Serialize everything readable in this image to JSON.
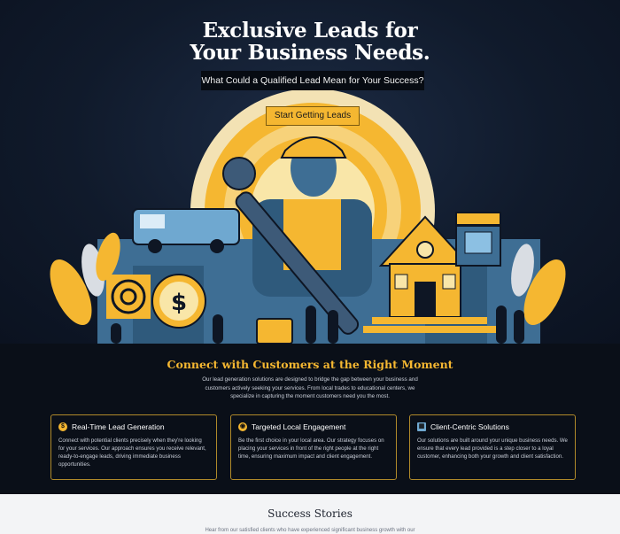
{
  "hero": {
    "title_line1": "Exclusive Leads for",
    "title_line2": "Your Business Needs.",
    "subtitle": "What Could a Qualified Lead Mean for Your Success?",
    "cta_label": "Start Getting Leads"
  },
  "connect": {
    "title": "Connect with Customers at the Right Moment",
    "text": "Our lead generation solutions are designed to bridge the gap between your business and customers actively seeking your services. From local trades to educational centers, we specialize in capturing the moment customers need you the most."
  },
  "cards": [
    {
      "icon": "dollar-icon",
      "title": "Real-Time Lead Generation",
      "body": "Connect with potential clients precisely when they're looking for your services. Our approach ensures you receive relevant, ready-to-engage leads, driving immediate business opportunities."
    },
    {
      "icon": "target-icon",
      "title": "Targeted Local Engagement",
      "body": "Be the first choice in your local area. Our strategy focuses on placing your services in front of the right people at the right time, ensuring maximum impact and client engagement."
    },
    {
      "icon": "building-icon",
      "title": "Client-Centric Solutions",
      "body": "Our solutions are built around your unique business needs. We ensure that every lead provided is a step closer to a loyal customer, enhancing both your growth and client satisfaction."
    }
  ],
  "stories": {
    "title": "Success Stories",
    "text": "Hear from our satisfied clients who have experienced significant business growth with our"
  },
  "colors": {
    "accent": "#f5b731",
    "dark_bg": "#0a0f18",
    "light_bg": "#f3f4f6"
  }
}
